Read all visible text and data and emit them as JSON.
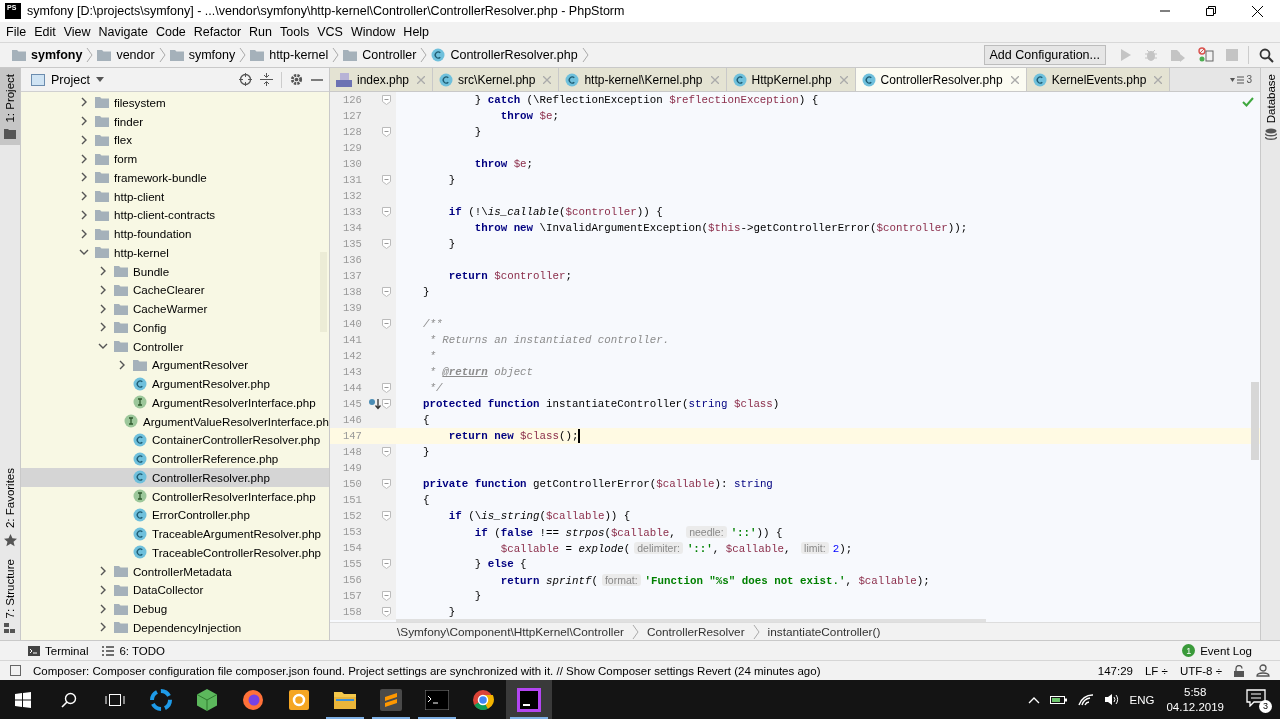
{
  "window": {
    "logo": "PS",
    "title": "symfony [D:\\projects\\symfony] - ...\\vendor\\symfony\\http-kernel\\Controller\\ControllerResolver.php - PhpStorm"
  },
  "menu": [
    "File",
    "Edit",
    "View",
    "Navigate",
    "Code",
    "Refactor",
    "Run",
    "Tools",
    "VCS",
    "Window",
    "Help"
  ],
  "navbar": {
    "crumbs": [
      {
        "label": "symfony",
        "kind": "root"
      },
      {
        "label": "vendor",
        "kind": "folder"
      },
      {
        "label": "symfony",
        "kind": "folder"
      },
      {
        "label": "http-kernel",
        "kind": "folder"
      },
      {
        "label": "Controller",
        "kind": "folder"
      },
      {
        "label": "ControllerResolver.php",
        "kind": "class"
      }
    ],
    "run_config": "Add Configuration..."
  },
  "left_strip": [
    {
      "label": "1: Project",
      "selected": true
    },
    {
      "label": "2: Favorites",
      "selected": false
    },
    {
      "label": "7: Structure",
      "selected": false
    }
  ],
  "project": {
    "title": "Project",
    "tree": [
      {
        "label": "filesystem",
        "kind": "folder",
        "expanded": false,
        "selected": false
      },
      {
        "label": "finder",
        "kind": "folder",
        "expanded": false,
        "selected": false
      },
      {
        "label": "flex",
        "kind": "folder",
        "expanded": false,
        "selected": false
      },
      {
        "label": "form",
        "kind": "folder",
        "expanded": false,
        "selected": false
      },
      {
        "label": "framework-bundle",
        "kind": "folder",
        "expanded": false,
        "selected": false
      },
      {
        "label": "http-client",
        "kind": "folder",
        "expanded": false,
        "selected": false
      },
      {
        "label": "http-client-contracts",
        "kind": "folder",
        "expanded": false,
        "selected": false
      },
      {
        "label": "http-foundation",
        "kind": "folder",
        "expanded": false,
        "selected": false
      },
      {
        "label": "http-kernel",
        "kind": "folder",
        "expanded": true,
        "selected": false,
        "children": [
          {
            "label": "Bundle",
            "kind": "folder",
            "expanded": false,
            "selected": false
          },
          {
            "label": "CacheClearer",
            "kind": "folder",
            "expanded": false,
            "selected": false
          },
          {
            "label": "CacheWarmer",
            "kind": "folder",
            "expanded": false,
            "selected": false
          },
          {
            "label": "Config",
            "kind": "folder",
            "expanded": false,
            "selected": false
          },
          {
            "label": "Controller",
            "kind": "folder",
            "expanded": true,
            "selected": false,
            "children": [
              {
                "label": "ArgumentResolver",
                "kind": "folder",
                "expanded": false,
                "selected": false
              },
              {
                "label": "ArgumentResolver.php",
                "kind": "class",
                "selected": false
              },
              {
                "label": "ArgumentResolverInterface.php",
                "kind": "interface",
                "selected": false
              },
              {
                "label": "ArgumentValueResolverInterface.ph",
                "kind": "interface",
                "selected": false
              },
              {
                "label": "ContainerControllerResolver.php",
                "kind": "class",
                "selected": false
              },
              {
                "label": "ControllerReference.php",
                "kind": "class",
                "selected": false
              },
              {
                "label": "ControllerResolver.php",
                "kind": "class",
                "selected": true
              },
              {
                "label": "ControllerResolverInterface.php",
                "kind": "interface",
                "selected": false
              },
              {
                "label": "ErrorController.php",
                "kind": "class",
                "selected": false
              },
              {
                "label": "TraceableArgumentResolver.php",
                "kind": "class",
                "selected": false
              },
              {
                "label": "TraceableControllerResolver.php",
                "kind": "class",
                "selected": false
              }
            ]
          },
          {
            "label": "ControllerMetadata",
            "kind": "folder",
            "expanded": false,
            "selected": false
          },
          {
            "label": "DataCollector",
            "kind": "folder",
            "expanded": false,
            "selected": false
          },
          {
            "label": "Debug",
            "kind": "folder",
            "expanded": false,
            "selected": false
          },
          {
            "label": "DependencyInjection",
            "kind": "folder",
            "expanded": false,
            "selected": false
          }
        ]
      }
    ]
  },
  "editor": {
    "tabs": [
      {
        "label": "index.php",
        "kind": "php",
        "selected": false
      },
      {
        "label": "src\\Kernel.php",
        "kind": "class",
        "selected": false
      },
      {
        "label": "http-kernel\\Kernel.php",
        "kind": "class",
        "selected": false
      },
      {
        "label": "HttpKernel.php",
        "kind": "class",
        "selected": false
      },
      {
        "label": "ControllerResolver.php",
        "kind": "class",
        "selected": true
      },
      {
        "label": "KernelEvents.php",
        "kind": "class",
        "selected": false
      }
    ],
    "tabs_overflow": "3",
    "lines": [
      {
        "number": "126",
        "fold": true,
        "tokens": [
          {
            "text": "            } ",
            "kind": "plain"
          },
          {
            "text": "catch",
            "kind": "keyword"
          },
          {
            "text": " (\\ReflectionException ",
            "kind": "plain"
          },
          {
            "text": "$reflectionException",
            "kind": "variable"
          },
          {
            "text": ") {",
            "kind": "plain"
          }
        ]
      },
      {
        "number": "127",
        "tokens": [
          {
            "text": "                throw",
            "kind": "keyword"
          },
          {
            "text": " $e",
            "kind": "variable"
          },
          {
            "text": ";",
            "kind": "plain"
          }
        ]
      },
      {
        "number": "128",
        "fold": true,
        "tokens": [
          {
            "text": "            }",
            "kind": "plain"
          }
        ]
      },
      {
        "number": "129"
      },
      {
        "number": "130",
        "tokens": [
          {
            "text": "            throw",
            "kind": "keyword"
          },
          {
            "text": " $e",
            "kind": "variable"
          },
          {
            "text": ";",
            "kind": "plain"
          }
        ]
      },
      {
        "number": "131",
        "fold": true,
        "tokens": [
          {
            "text": "        }",
            "kind": "plain"
          }
        ]
      },
      {
        "number": "132"
      },
      {
        "number": "133",
        "fold": true,
        "tokens": [
          {
            "text": "        if",
            "kind": "keyword"
          },
          {
            "text": " (!\\",
            "kind": "plain"
          },
          {
            "text": "is_callable",
            "kind": "function"
          },
          {
            "text": "(",
            "kind": "plain"
          },
          {
            "text": "$controller",
            "kind": "variable"
          },
          {
            "text": ")) {",
            "kind": "plain"
          }
        ]
      },
      {
        "number": "134",
        "tokens": [
          {
            "text": "            throw new",
            "kind": "keyword"
          },
          {
            "text": " \\InvalidArgumentException(",
            "kind": "plain"
          },
          {
            "text": "$this",
            "kind": "variable"
          },
          {
            "text": "->getControllerError(",
            "kind": "plain"
          },
          {
            "text": "$controller",
            "kind": "variable"
          },
          {
            "text": "));",
            "kind": "plain"
          }
        ]
      },
      {
        "number": "135",
        "fold": true,
        "tokens": [
          {
            "text": "        }",
            "kind": "plain"
          }
        ]
      },
      {
        "number": "136"
      },
      {
        "number": "137",
        "tokens": [
          {
            "text": "        return",
            "kind": "keyword"
          },
          {
            "text": " $controller",
            "kind": "variable"
          },
          {
            "text": ";",
            "kind": "plain"
          }
        ]
      },
      {
        "number": "138",
        "fold": true,
        "tokens": [
          {
            "text": "    }",
            "kind": "plain"
          }
        ]
      },
      {
        "number": "139"
      },
      {
        "number": "140",
        "fold": true,
        "tokens": [
          {
            "text": "    /**",
            "kind": "comment"
          }
        ]
      },
      {
        "number": "141",
        "tokens": [
          {
            "text": "     * Returns an instantiated controller.",
            "kind": "comment"
          }
        ]
      },
      {
        "number": "142",
        "tokens": [
          {
            "text": "     *",
            "kind": "comment"
          }
        ]
      },
      {
        "number": "143",
        "tokens": [
          {
            "text": "     * ",
            "kind": "comment"
          },
          {
            "text": "@return",
            "kind": "doctag"
          },
          {
            "text": " object",
            "kind": "comment"
          }
        ]
      },
      {
        "number": "144",
        "fold": true,
        "tokens": [
          {
            "text": "     */",
            "kind": "comment"
          }
        ]
      },
      {
        "number": "145",
        "fold": true,
        "override": true,
        "tokens": [
          {
            "text": "    protected function",
            "kind": "keyword"
          },
          {
            "text": " instantiateController(",
            "kind": "plain"
          },
          {
            "text": "string",
            "kind": "type"
          },
          {
            "text": " $class",
            "kind": "variable"
          },
          {
            "text": ")",
            "kind": "plain"
          }
        ]
      },
      {
        "number": "146",
        "tokens": [
          {
            "text": "    {",
            "kind": "plain"
          }
        ]
      },
      {
        "number": "147",
        "current": true,
        "tokens": [
          {
            "text": "        return new",
            "kind": "keyword"
          },
          {
            "text": " $class",
            "kind": "variable"
          },
          {
            "text": "();",
            "kind": "plain"
          }
        ]
      },
      {
        "number": "148",
        "fold": true,
        "tokens": [
          {
            "text": "    }",
            "kind": "plain"
          }
        ]
      },
      {
        "number": "149"
      },
      {
        "number": "150",
        "fold": true,
        "tokens": [
          {
            "text": "    private function",
            "kind": "keyword"
          },
          {
            "text": " getControllerError(",
            "kind": "plain"
          },
          {
            "text": "$callable",
            "kind": "variable"
          },
          {
            "text": "): ",
            "kind": "plain"
          },
          {
            "text": "string",
            "kind": "type"
          }
        ]
      },
      {
        "number": "151",
        "tokens": [
          {
            "text": "    {",
            "kind": "plain"
          }
        ]
      },
      {
        "number": "152",
        "fold": true,
        "tokens": [
          {
            "text": "        if",
            "kind": "keyword"
          },
          {
            "text": " (\\",
            "kind": "plain"
          },
          {
            "text": "is_string",
            "kind": "function"
          },
          {
            "text": "(",
            "kind": "plain"
          },
          {
            "text": "$callable",
            "kind": "variable"
          },
          {
            "text": ")) {",
            "kind": "plain"
          }
        ]
      },
      {
        "number": "153",
        "tokens": [
          {
            "text": "            if",
            "kind": "keyword"
          },
          {
            "text": " (",
            "kind": "plain"
          },
          {
            "text": "false",
            "kind": "keyword"
          },
          {
            "text": " !== ",
            "kind": "plain"
          },
          {
            "text": "strpos",
            "kind": "function"
          },
          {
            "text": "(",
            "kind": "plain"
          },
          {
            "text": "$callable",
            "kind": "variable"
          },
          {
            "text": ", ",
            "kind": "plain"
          },
          {
            "text": "needle:",
            "kind": "hint"
          },
          {
            "text": "'::'",
            "kind": "string"
          },
          {
            "text": ")) {",
            "kind": "plain"
          }
        ]
      },
      {
        "number": "154",
        "tokens": [
          {
            "text": "                $callable",
            "kind": "variable"
          },
          {
            "text": " = ",
            "kind": "plain"
          },
          {
            "text": "explode",
            "kind": "function"
          },
          {
            "text": "(",
            "kind": "plain"
          },
          {
            "text": "delimiter:",
            "kind": "hint"
          },
          {
            "text": "'::'",
            "kind": "string"
          },
          {
            "text": ", ",
            "kind": "plain"
          },
          {
            "text": "$callable",
            "kind": "variable"
          },
          {
            "text": ", ",
            "kind": "plain"
          },
          {
            "text": "limit:",
            "kind": "hint"
          },
          {
            "text": "2",
            "kind": "number"
          },
          {
            "text": ");",
            "kind": "plain"
          }
        ]
      },
      {
        "number": "155",
        "fold": true,
        "tokens": [
          {
            "text": "            } ",
            "kind": "plain"
          },
          {
            "text": "else",
            "kind": "keyword"
          },
          {
            "text": " {",
            "kind": "plain"
          }
        ]
      },
      {
        "number": "156",
        "tokens": [
          {
            "text": "                return",
            "kind": "keyword"
          },
          {
            "text": " sprintf",
            "kind": "function"
          },
          {
            "text": "(",
            "kind": "plain"
          },
          {
            "text": "format:",
            "kind": "hint"
          },
          {
            "text": "'Function \"%s\" does not exist.'",
            "kind": "string"
          },
          {
            "text": ", ",
            "kind": "plain"
          },
          {
            "text": "$callable",
            "kind": "variable"
          },
          {
            "text": ");",
            "kind": "plain"
          }
        ]
      },
      {
        "number": "157",
        "fold": true,
        "tokens": [
          {
            "text": "            }",
            "kind": "plain"
          }
        ]
      },
      {
        "number": "158",
        "fold": true,
        "tokens": [
          {
            "text": "        }",
            "kind": "plain"
          }
        ]
      }
    ],
    "breadcrumb": [
      "\\Symfony\\Component\\HttpKernel\\Controller",
      "ControllerResolver",
      "instantiateController()"
    ]
  },
  "right_strip": [
    {
      "label": "Database",
      "selected": false
    }
  ],
  "tool_buttons": [
    "Terminal",
    "6: TODO"
  ],
  "event_log": {
    "label": "Event Log",
    "count": "1"
  },
  "status": {
    "message": "Composer: Composer configuration file composer.json found. Project settings are synchronized with it. // Show Composer settings Revert (24 minutes ago)",
    "position": "147:29",
    "line_separator": "LF ÷",
    "encoding": "UTF-8 ÷"
  },
  "taskbar": {
    "apps": [
      {
        "running": false,
        "selected": false
      },
      {
        "running": false,
        "selected": false
      },
      {
        "running": false,
        "selected": false
      },
      {
        "running": false,
        "selected": false
      },
      {
        "running": true,
        "selected": false
      },
      {
        "running": true,
        "selected": false
      },
      {
        "running": true,
        "selected": false
      },
      {
        "running": false,
        "selected": false
      },
      {
        "running": true,
        "selected": true
      }
    ],
    "language": "ENG",
    "time": "5:58",
    "date": "04.12.2019",
    "notifications": "3"
  }
}
